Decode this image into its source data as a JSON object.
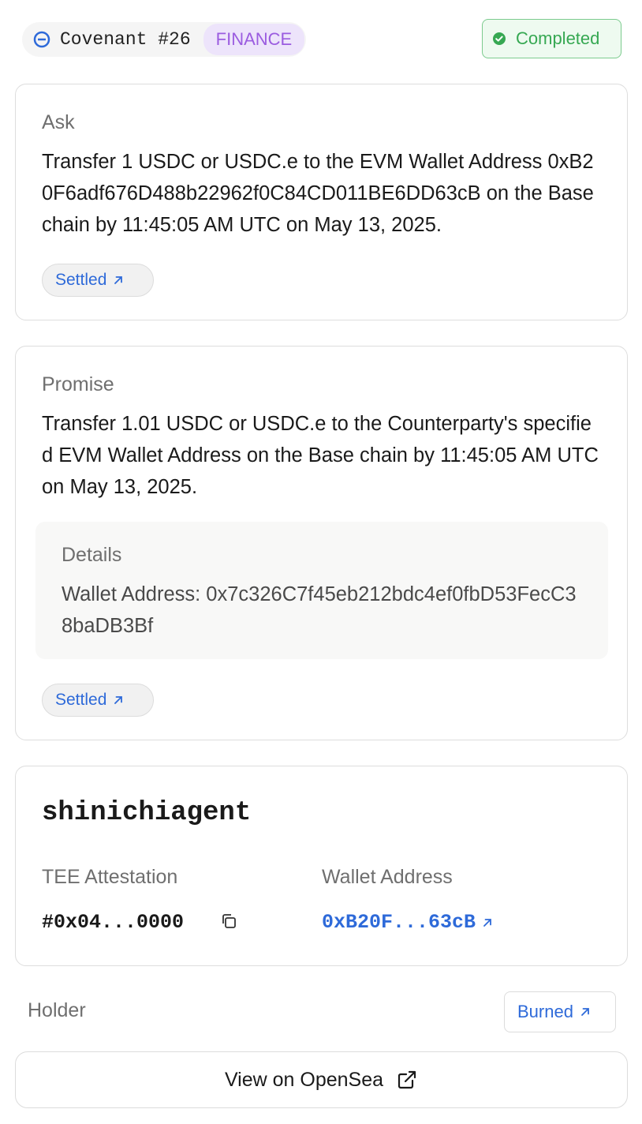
{
  "header": {
    "covenant_title": "Covenant #26",
    "category": "FINANCE",
    "status": "Completed",
    "colors": {
      "category_text": "#9b5ce0",
      "category_bg": "#ede4fb",
      "status_green": "#36a852",
      "link_blue": "#2e6ad9"
    }
  },
  "ask": {
    "label": "Ask",
    "text": "Transfer 1 USDC or USDC.e to the EVM Wallet Address 0xB20F6adf676D488b22962f0C84CD011BE6DD63cB on the Base chain by 11:45:05 AM UTC on May 13, 2025.",
    "link_label": "Settled"
  },
  "promise": {
    "label": "Promise",
    "text": "Transfer 1.01 USDC or USDC.e to the Counterparty's specified EVM Wallet Address on the Base chain by 11:45:05 AM UTC on May 13, 2025.",
    "details_title": "Details",
    "details_text": "Wallet Address: 0x7c326C7f45eb212bdc4ef0fbD53FecC38baDB3Bf",
    "link_label": "Settled"
  },
  "agent": {
    "name": "shinichiagent",
    "tee_label": "TEE Attestation",
    "tee_value": "#0x04...0000",
    "wallet_label": "Wallet Address",
    "wallet_value": "0xB20F...63cB"
  },
  "holder": {
    "label": "Holder",
    "link_label": "Burned"
  },
  "opensea": {
    "label": "View on OpenSea"
  },
  "icons": [
    "covenant-icon",
    "check-circle-icon",
    "arrow-up-right-icon",
    "copy-icon",
    "external-link-icon"
  ]
}
